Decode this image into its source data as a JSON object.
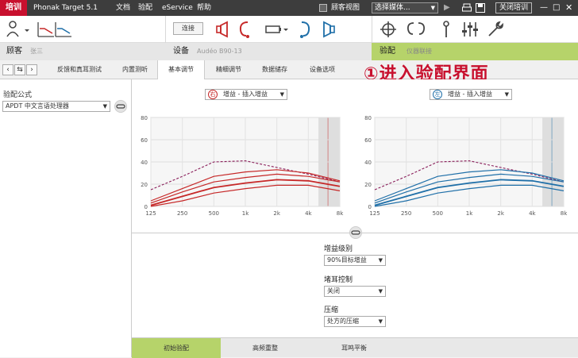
{
  "titlebar": {
    "training": "培训",
    "app_title": "Phonak Target 5.1",
    "menu": [
      "文档",
      "验配",
      "eService",
      "帮助"
    ],
    "customer_view": "顾客视图",
    "media_select": "选择媒体...",
    "close_training": "关闭培训"
  },
  "section": {
    "customer_label": "顾客",
    "customer_name": "张三",
    "device_label": "设备",
    "device_name": "Audéo B90-13",
    "fitting_label": "验配",
    "fitting_sub": "仪器联接"
  },
  "toolbar": {
    "connect_label": "连接"
  },
  "tabs": [
    "反馈和真耳测试",
    "内置测听",
    "基本调节",
    "精细调节",
    "数据储存",
    "设备选项"
  ],
  "overlay_text": "①进入验配界面",
  "left_panel": {
    "formula_label": "验配公式",
    "formula_value": "APDT 中文言语处理器"
  },
  "charts": {
    "right_ear_mode": "增益 - 插入增益",
    "left_ear_mode": "增益 - 插入增益",
    "right_ear_badge": "右",
    "left_ear_badge": "左",
    "right_color": "#c62828",
    "left_color": "#1f6fa8"
  },
  "chart_data": [
    {
      "type": "line",
      "ear": "right",
      "x": [
        125,
        250,
        500,
        1000,
        2000,
        4000,
        8000
      ],
      "xticks": [
        "125",
        "250",
        "500",
        "1k",
        "2k",
        "4k",
        "8k"
      ],
      "ylim": [
        0,
        80
      ],
      "yticks": [
        0,
        20,
        40,
        60,
        80
      ],
      "series": [
        {
          "values": [
            15,
            27,
            40,
            41,
            35,
            29,
            22
          ]
        },
        {
          "values": [
            5,
            16,
            27,
            31,
            33,
            30,
            23
          ]
        },
        {
          "values": [
            3,
            13,
            22,
            26,
            29,
            27,
            22
          ]
        },
        {
          "values": [
            1,
            9,
            17,
            21,
            24,
            23,
            18
          ]
        },
        {
          "values": [
            0,
            5,
            12,
            16,
            19,
            19,
            14
          ]
        }
      ]
    },
    {
      "type": "line",
      "ear": "left",
      "x": [
        125,
        250,
        500,
        1000,
        2000,
        4000,
        8000
      ],
      "xticks": [
        "125",
        "250",
        "500",
        "1k",
        "2k",
        "4k",
        "8k"
      ],
      "ylim": [
        0,
        80
      ],
      "yticks": [
        0,
        20,
        40,
        60,
        80
      ],
      "series": [
        {
          "values": [
            15,
            27,
            40,
            41,
            35,
            29,
            22
          ]
        },
        {
          "values": [
            5,
            16,
            27,
            31,
            33,
            30,
            23
          ]
        },
        {
          "values": [
            3,
            13,
            22,
            26,
            29,
            27,
            22
          ]
        },
        {
          "values": [
            1,
            9,
            17,
            21,
            24,
            23,
            18
          ]
        },
        {
          "values": [
            0,
            5,
            12,
            16,
            19,
            19,
            14
          ]
        }
      ]
    }
  ],
  "controls": {
    "gain_level_label": "增益级别",
    "gain_level_value": "90%目标增益",
    "occlusion_label": "堵耳控制",
    "occlusion_value": "关闭",
    "compression_label": "压缩",
    "compression_value": "处方的压缩"
  },
  "bottom_tabs": [
    "初始验配",
    "高频重整",
    "耳鸣平衡"
  ]
}
